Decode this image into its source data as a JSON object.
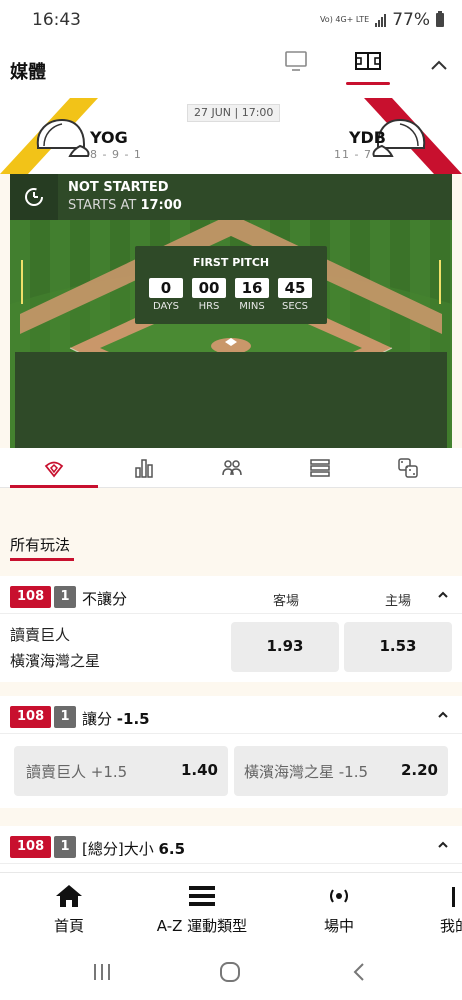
{
  "statusbar": {
    "time": "16:43",
    "network": "Vo) 4G+ LTE",
    "battery": "77%"
  },
  "media": {
    "title": "媒體"
  },
  "match": {
    "date": "27 JUN | 17:00",
    "away": {
      "abbr": "YOG",
      "record": "8 - 9 - 1",
      "color": "#f2c318"
    },
    "home": {
      "abbr": "YDB",
      "record": "11 - 7",
      "color": "#c8102e"
    }
  },
  "game_status": {
    "state": "NOT STARTED",
    "starts_prefix": "STARTS AT",
    "starts_time": "17:00",
    "countdown_label": "FIRST PITCH",
    "countdown": [
      {
        "value": "0",
        "unit": "DAYS"
      },
      {
        "value": "00",
        "unit": "HRS"
      },
      {
        "value": "16",
        "unit": "MINS"
      },
      {
        "value": "45",
        "unit": "SECS"
      }
    ]
  },
  "tabs": [
    "field-icon",
    "stats-icon",
    "lineup-icon",
    "list-icon",
    "dice-icon"
  ],
  "section": {
    "title": "所有玩法"
  },
  "markets": [
    {
      "code": "108",
      "num": "1",
      "name": "不讓分",
      "name_bold": "",
      "col_away": "客場",
      "col_home": "主場",
      "team_away": "讀賣巨人",
      "team_home": "橫濱海灣之星",
      "odds_away": "1.93",
      "odds_home": "1.53"
    },
    {
      "code": "108",
      "num": "1",
      "name": "讓分 ",
      "name_bold": "-1.5",
      "sel_away": "讀賣巨人 +1.5",
      "odds_away": "1.40",
      "sel_home": "橫濱海灣之星 -1.5",
      "odds_home": "2.20"
    },
    {
      "code": "108",
      "num": "1",
      "name": "[總分]大小 ",
      "name_bold": "6.5"
    }
  ],
  "bottom_nav": [
    {
      "label": "首頁",
      "icon": "home-icon"
    },
    {
      "label": "A-Z 運動類型",
      "icon": "menu-icon"
    },
    {
      "label": "場中",
      "icon": "live-icon"
    },
    {
      "label": "我的",
      "icon": "user-icon"
    }
  ],
  "colors": {
    "accent": "#c8102e",
    "dark_green": "#2f4a28",
    "grass": "#3f7a2c"
  }
}
